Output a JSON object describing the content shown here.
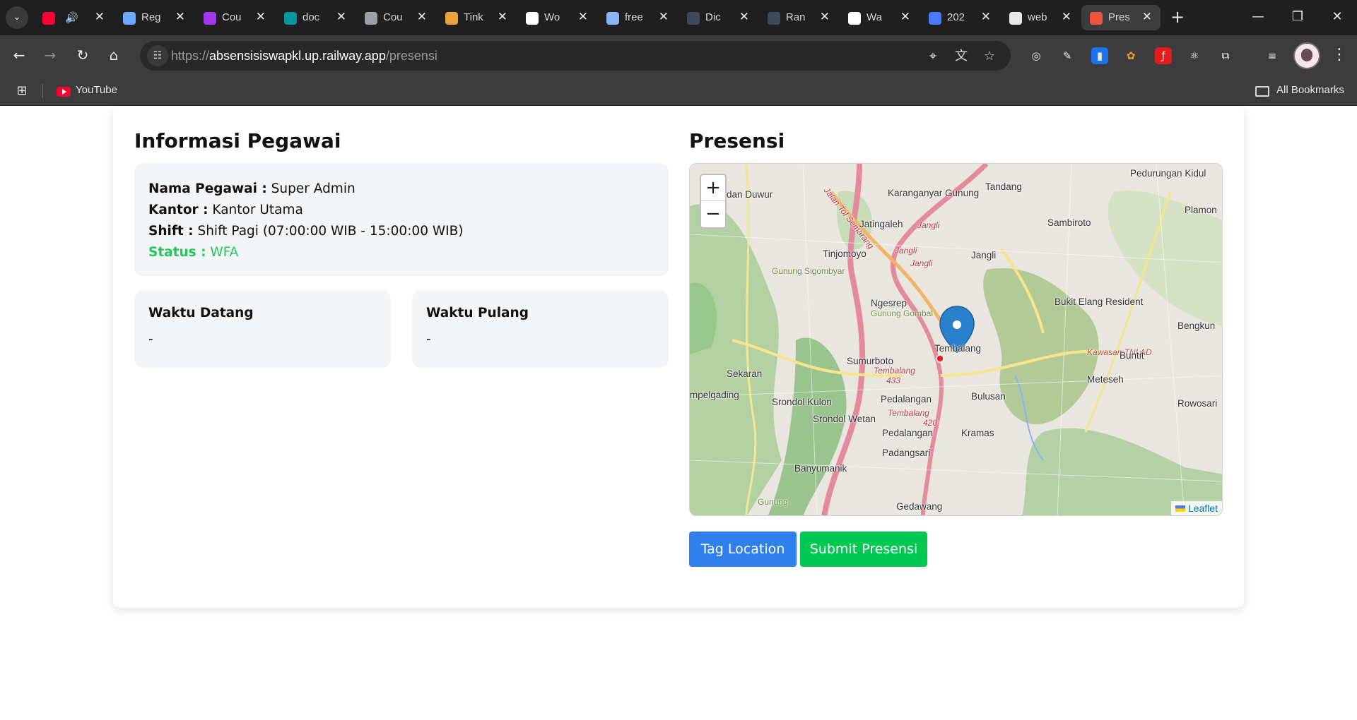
{
  "browser": {
    "tabs": [
      {
        "title": "",
        "icon": "youtube-icon",
        "color": "#ff0033",
        "audio": true
      },
      {
        "title": "Reg",
        "icon": "puzzle-icon",
        "color": "#6aa9ff"
      },
      {
        "title": "Cou",
        "icon": "udemy-icon",
        "color": "#a435f0"
      },
      {
        "title": "doc",
        "icon": "arduino-icon",
        "color": "#00979d"
      },
      {
        "title": "Cou",
        "icon": "globe-icon",
        "color": "#9aa0a6"
      },
      {
        "title": "Tink",
        "icon": "tinkercad-icon",
        "color": "#e8a33a"
      },
      {
        "title": "Wo",
        "icon": "wordpress-icon",
        "color": "#ffffff"
      },
      {
        "title": "free",
        "icon": "code-icon",
        "color": "#8ab4f8"
      },
      {
        "title": "Dic",
        "icon": "g-icon",
        "color": "#3c4a5a"
      },
      {
        "title": "Ran",
        "icon": "g-icon",
        "color": "#3c4a5a"
      },
      {
        "title": "Wa",
        "icon": "chatgpt-icon",
        "color": "#ffffff"
      },
      {
        "title": "202",
        "icon": "dart-icon",
        "color": "#4a7bff"
      },
      {
        "title": "web",
        "icon": "circle-icon",
        "color": "#e8e8e8"
      },
      {
        "title": "Pres",
        "icon": "laravel-icon",
        "color": "#f05340",
        "active": true
      }
    ],
    "url_prefix": "https://",
    "url_host": "absensisiswapkl.up.railway.app",
    "url_path": "/presensi",
    "bookmark_youtube": "YouTube",
    "all_bookmarks": "All Bookmarks"
  },
  "page": {
    "info_title": "Informasi Pegawai",
    "presensi_title": "Presensi",
    "employee": {
      "name_label": "Nama Pegawai :",
      "name_value": "Super Admin",
      "office_label": "Kantor :",
      "office_value": "Kantor Utama",
      "shift_label": "Shift :",
      "shift_value": "Shift Pagi (07:00:00 WIB - 15:00:00 WIB)",
      "status_label": "Status :",
      "status_value": "WFA",
      "status_color": "#22c55e"
    },
    "arrival_label": "Waktu Datang",
    "arrival_value": "-",
    "departure_label": "Waktu Pulang",
    "departure_value": "-",
    "tag_location_label": "Tag Location",
    "submit_label": "Submit Presensi",
    "tag_color": "#2f80ed",
    "submit_color": "#00c853"
  },
  "map": {
    "zoom_in": "+",
    "zoom_out": "−",
    "attribution": "Leaflet",
    "places": [
      "Pedurungan Kidul",
      "Tandang",
      "Karanganyar Gunung",
      "dan Duwur",
      "Plamon",
      "Jatingaleh",
      "Sambiroto",
      "Jangli",
      "Tinjomoyo",
      "Jangli",
      "Gunung Sigombyar",
      "Ngesrep",
      "Gunung Gombal",
      "Bukit Elang Resident",
      "Bengkun",
      "Tembalang",
      "Sumurboto",
      "Kawasan TNI AD",
      "Buntit",
      "Sekaran",
      "Meteseh",
      "mpelgading",
      "Srondol Kulon",
      "Pedalangan",
      "Bulusan",
      "Rowosari",
      "Srondol Wetan",
      "Pedalangan",
      "Kramas",
      "Padangsari",
      "Banyumanik",
      "Gunung",
      "Gedawang",
      "Jangli",
      "Jangli",
      "Tembalang",
      "Tembalang",
      "433",
      "420",
      "Jalan Tol Semarang"
    ]
  }
}
